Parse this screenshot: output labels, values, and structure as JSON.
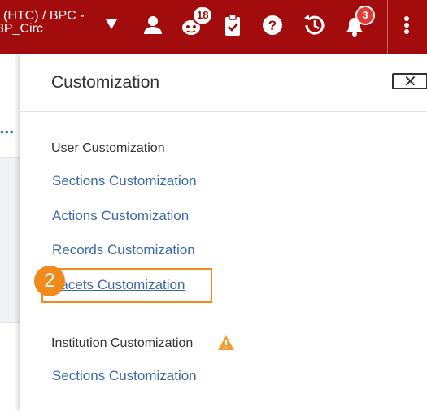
{
  "header": {
    "context_line1": "l (HTC) / BPC -",
    "context_line2": "3P_Circ",
    "tasks_badge": "18",
    "notifications_badge": "3",
    "colors": {
      "bar": "#a30c0c",
      "badge_red": "#e53935"
    }
  },
  "panel": {
    "title": "Customization",
    "close_label": "✕",
    "user_section": {
      "heading": "User Customization",
      "links": [
        "Sections Customization",
        "Actions Customization",
        "Records Customization",
        "Facets Customization"
      ]
    },
    "institution_section": {
      "heading": "Institution Customization",
      "links": [
        "Sections Customization"
      ]
    },
    "annotation": {
      "step": "2",
      "color": "#f18a1c"
    }
  },
  "leftpane": {
    "dots": "•••"
  }
}
